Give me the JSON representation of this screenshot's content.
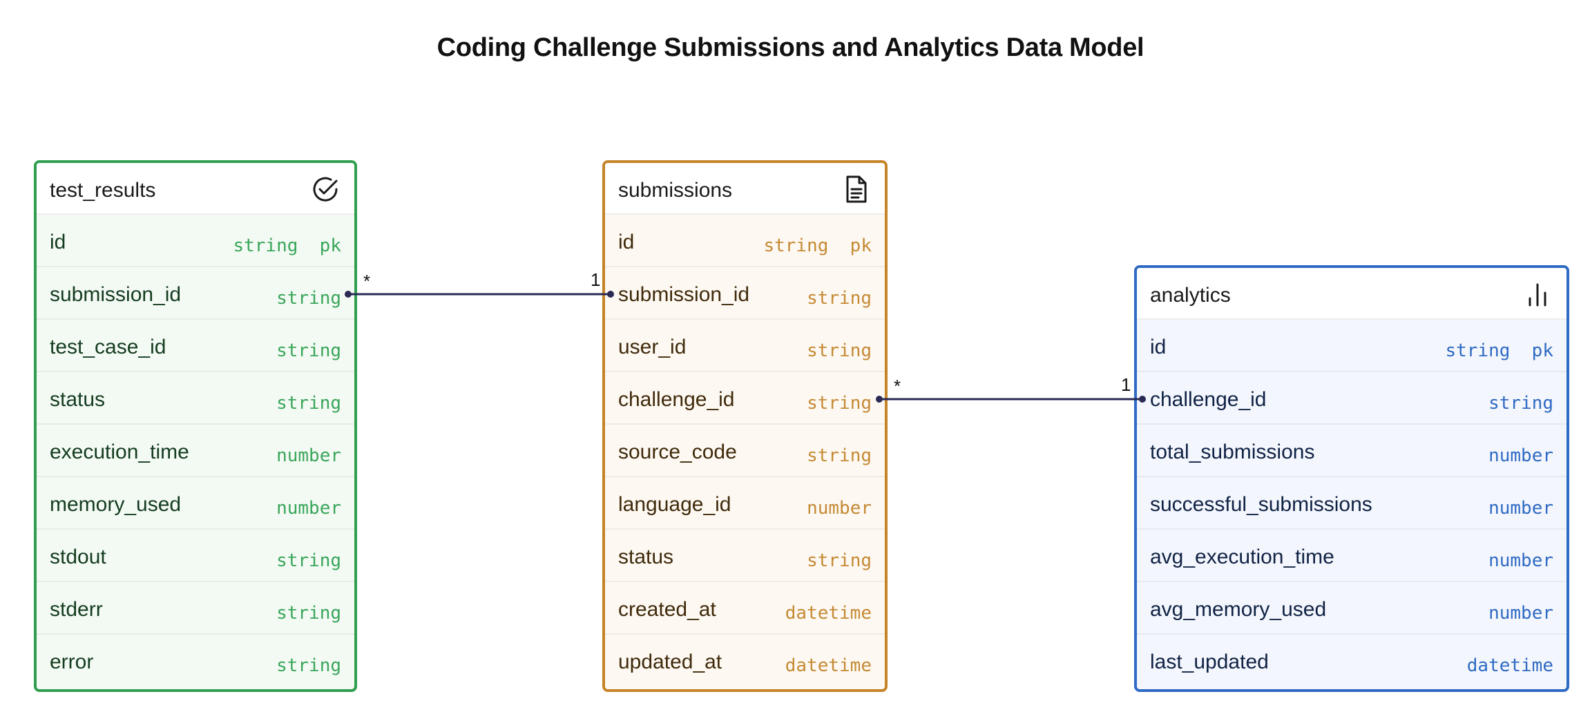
{
  "title": "Coding Challenge Submissions and Analytics Data Model",
  "entities": {
    "test_results": {
      "name": "test_results",
      "icon": "check-circle-icon",
      "color": "#2f9e4f",
      "fields": [
        {
          "name": "id",
          "type": "string  pk"
        },
        {
          "name": "submission_id",
          "type": "string"
        },
        {
          "name": "test_case_id",
          "type": "string"
        },
        {
          "name": "status",
          "type": "string"
        },
        {
          "name": "execution_time",
          "type": "number"
        },
        {
          "name": "memory_used",
          "type": "number"
        },
        {
          "name": "stdout",
          "type": "string"
        },
        {
          "name": "stderr",
          "type": "string"
        },
        {
          "name": "error",
          "type": "string"
        }
      ]
    },
    "submissions": {
      "name": "submissions",
      "icon": "document-icon",
      "color": "#c58428",
      "fields": [
        {
          "name": "id",
          "type": "string  pk"
        },
        {
          "name": "submission_id",
          "type": "string"
        },
        {
          "name": "user_id",
          "type": "string"
        },
        {
          "name": "challenge_id",
          "type": "string"
        },
        {
          "name": "source_code",
          "type": "string"
        },
        {
          "name": "language_id",
          "type": "number"
        },
        {
          "name": "status",
          "type": "string"
        },
        {
          "name": "created_at",
          "type": "datetime"
        },
        {
          "name": "updated_at",
          "type": "datetime"
        }
      ]
    },
    "analytics": {
      "name": "analytics",
      "icon": "bar-chart-icon",
      "color": "#2f6ac4",
      "fields": [
        {
          "name": "id",
          "type": "string  pk"
        },
        {
          "name": "challenge_id",
          "type": "string"
        },
        {
          "name": "total_submissions",
          "type": "number"
        },
        {
          "name": "successful_submissions",
          "type": "number"
        },
        {
          "name": "avg_execution_time",
          "type": "number"
        },
        {
          "name": "avg_memory_used",
          "type": "number"
        },
        {
          "name": "last_updated",
          "type": "datetime"
        }
      ]
    }
  },
  "relationships": [
    {
      "from": "test_results.submission_id",
      "to": "submissions.submission_id",
      "from_cardinality": "*",
      "to_cardinality": "1"
    },
    {
      "from": "submissions.challenge_id",
      "to": "analytics.challenge_id",
      "from_cardinality": "*",
      "to_cardinality": "1"
    }
  ],
  "line_color": "#2a2a55"
}
